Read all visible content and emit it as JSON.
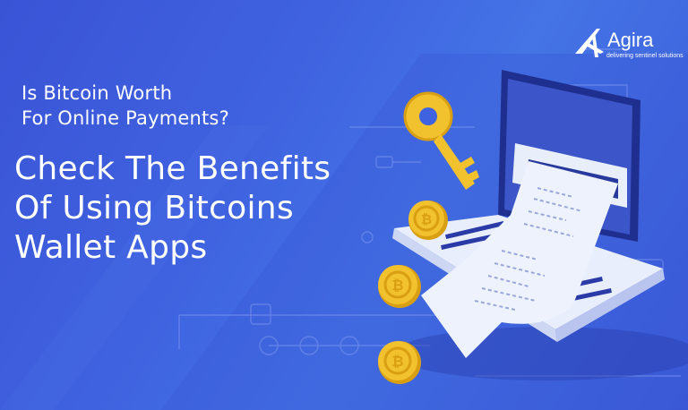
{
  "brand": {
    "name": "Agira",
    "tagline": "delivering sentinel solutions"
  },
  "headline": {
    "question_line_1": "Is Bitcoin Worth",
    "question_line_2": "For Online Payments?",
    "title_line_1": "Check The Benefits",
    "title_line_2": "Of Using Bitcoins",
    "title_line_3": "Wallet Apps"
  },
  "colors": {
    "background": "#3f62e0",
    "laptop_screen": "#1f2f8f",
    "laptop_base": "#e8eefb",
    "coin": "#f2c12e",
    "receipt": "#eef2fc"
  },
  "icons": [
    "agira-logo-icon",
    "laptop-icon",
    "key-icon",
    "bitcoin-coin-icon",
    "receipt-icon"
  ]
}
